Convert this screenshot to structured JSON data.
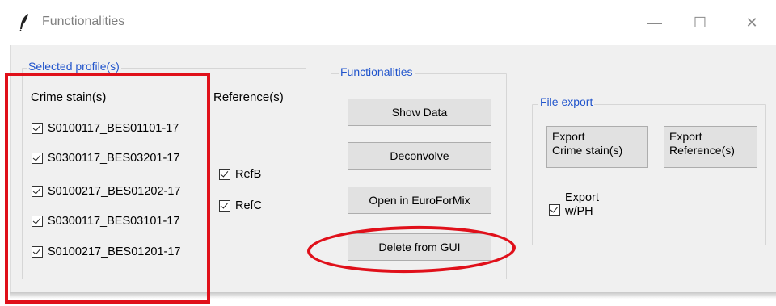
{
  "window": {
    "title": "Functionalities",
    "controls": {
      "minimize": "—",
      "maximize": "☐",
      "close": "✕"
    }
  },
  "selected_profiles": {
    "legend": "Selected profile(s)",
    "crime_stains": {
      "header": "Crime stain(s)",
      "items": [
        {
          "label": "S0100117_BES01101-17",
          "checked": true
        },
        {
          "label": "S0300117_BES03201-17",
          "checked": true
        },
        {
          "label": "S0100217_BES01202-17",
          "checked": true
        },
        {
          "label": "S0300117_BES03101-17",
          "checked": true
        },
        {
          "label": "S0100217_BES01201-17",
          "checked": true
        }
      ]
    },
    "references": {
      "header": "Reference(s)",
      "items": [
        {
          "label": "RefB",
          "checked": true
        },
        {
          "label": "RefC",
          "checked": true
        }
      ]
    }
  },
  "functionalities": {
    "legend": "Functionalities",
    "buttons": [
      "Show Data",
      "Deconvolve",
      "Open in EuroForMix",
      "Delete from GUI"
    ]
  },
  "file_export": {
    "legend": "File export",
    "export_crime_line1": "Export",
    "export_crime_line2": "Crime stain(s)",
    "export_ref_line1": "Export",
    "export_ref_line2": "Reference(s)",
    "export_ph_line1": "Export",
    "export_ph_line2": "w/PH",
    "export_ph_checked": true
  },
  "annotation_color": "#e0101a"
}
